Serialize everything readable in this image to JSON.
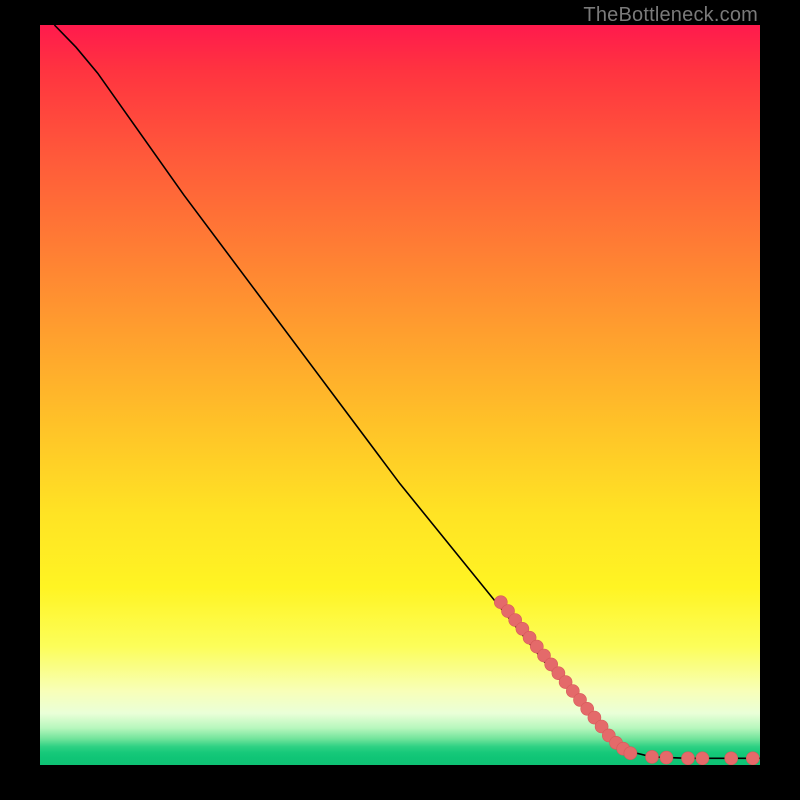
{
  "attribution": "TheBottleneck.com",
  "chart_data": {
    "type": "line",
    "title": "",
    "xlabel": "",
    "ylabel": "",
    "xlim": [
      0,
      100
    ],
    "ylim": [
      0,
      100
    ],
    "curve": {
      "name": "bottleneck-curve",
      "points": [
        {
          "x": 2,
          "y": 100
        },
        {
          "x": 5,
          "y": 97
        },
        {
          "x": 8,
          "y": 93.5
        },
        {
          "x": 12,
          "y": 88
        },
        {
          "x": 20,
          "y": 77
        },
        {
          "x": 30,
          "y": 64
        },
        {
          "x": 40,
          "y": 51
        },
        {
          "x": 50,
          "y": 38
        },
        {
          "x": 60,
          "y": 26
        },
        {
          "x": 70,
          "y": 14
        },
        {
          "x": 78,
          "y": 5
        },
        {
          "x": 82,
          "y": 1.8
        },
        {
          "x": 85,
          "y": 1.1
        },
        {
          "x": 90,
          "y": 0.9
        },
        {
          "x": 95,
          "y": 0.9
        },
        {
          "x": 100,
          "y": 0.9
        }
      ]
    },
    "series": [
      {
        "name": "highlighted-points",
        "color": "#e46a6a",
        "points": [
          {
            "x": 64,
            "y": 22.0
          },
          {
            "x": 65,
            "y": 20.8
          },
          {
            "x": 66,
            "y": 19.6
          },
          {
            "x": 67,
            "y": 18.4
          },
          {
            "x": 68,
            "y": 17.2
          },
          {
            "x": 69,
            "y": 16.0
          },
          {
            "x": 70,
            "y": 14.8
          },
          {
            "x": 71,
            "y": 13.6
          },
          {
            "x": 72,
            "y": 12.4
          },
          {
            "x": 73,
            "y": 11.2
          },
          {
            "x": 74,
            "y": 10.0
          },
          {
            "x": 75,
            "y": 8.8
          },
          {
            "x": 76,
            "y": 7.6
          },
          {
            "x": 77,
            "y": 6.4
          },
          {
            "x": 78,
            "y": 5.2
          },
          {
            "x": 79,
            "y": 4.0
          },
          {
            "x": 80,
            "y": 3.0
          },
          {
            "x": 81,
            "y": 2.2
          },
          {
            "x": 82,
            "y": 1.6
          },
          {
            "x": 85,
            "y": 1.1
          },
          {
            "x": 87,
            "y": 1.0
          },
          {
            "x": 90,
            "y": 0.9
          },
          {
            "x": 92,
            "y": 0.9
          },
          {
            "x": 96,
            "y": 0.9
          },
          {
            "x": 99,
            "y": 0.9
          }
        ]
      }
    ]
  }
}
